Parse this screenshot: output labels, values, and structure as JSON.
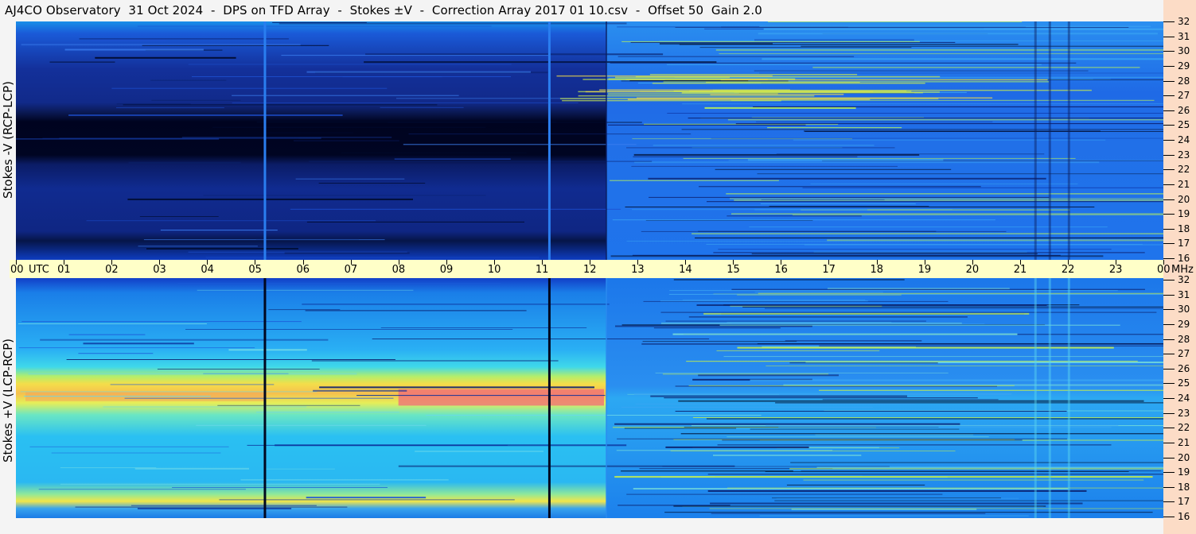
{
  "header": {
    "title": "AJ4CO Observatory  31 Oct 2024  -  DPS on TFD Array  -  Stokes ±V  -  Correction Array 2017 01 10.csv  -  Offset 50  Gain 2.0"
  },
  "colors": {
    "upper_deep": "#000a2a",
    "upper_mid": "#0d2d99",
    "upper_light": "#1a53d6",
    "lower_mid": "#1b8ef0",
    "lower_cyan": "#2ad0f5",
    "lower_yellow": "#e8f04a",
    "lower_red": "#f06a7a",
    "post_sunrise": "#1f6ff0",
    "timebar_bg": "#ffffc8",
    "freqbar_bg": "#fcdcc6"
  },
  "chart_data": [
    {
      "type": "heatmap",
      "panel": "top",
      "ylabel": "Stokes -V (RCP-LCP)",
      "x_unit": "UTC",
      "y_unit": "MHz",
      "xlim": [
        0,
        24
      ],
      "ylim": [
        16,
        32
      ],
      "x_ticks": [
        "00",
        "01",
        "02",
        "03",
        "04",
        "05",
        "06",
        "07",
        "08",
        "09",
        "10",
        "11",
        "12",
        "13",
        "14",
        "15",
        "16",
        "17",
        "18",
        "19",
        "20",
        "21",
        "22",
        "23",
        "00"
      ],
      "y_ticks": [
        "16",
        "17",
        "18",
        "19",
        "20",
        "21",
        "22",
        "23",
        "24",
        "25",
        "26",
        "27",
        "28",
        "29",
        "30",
        "31",
        "32"
      ],
      "events": [
        {
          "hour": 5.2,
          "kind": "bright vertical line"
        },
        {
          "hour": 11.15,
          "kind": "bright vertical line"
        },
        {
          "hour": 12.35,
          "kind": "background level change"
        }
      ],
      "features": [
        {
          "from_hour": 0,
          "to_hour": 11.2,
          "freq_lo": 22.8,
          "freq_hi": 24.8,
          "level": "very low"
        },
        {
          "from_hour": 11.2,
          "to_hour": 24,
          "freq_lo": 26.6,
          "freq_hi": 28.6,
          "level": "high, yellow streaks"
        }
      ]
    },
    {
      "type": "heatmap",
      "panel": "bottom",
      "ylabel": "Stokes +V (LCP-RCP)",
      "x_unit": "UTC",
      "y_unit": "MHz",
      "xlim": [
        0,
        24
      ],
      "ylim": [
        16,
        32
      ],
      "x_ticks": [
        "00",
        "01",
        "02",
        "03",
        "04",
        "05",
        "06",
        "07",
        "08",
        "09",
        "10",
        "11",
        "12",
        "13",
        "14",
        "15",
        "16",
        "17",
        "18",
        "19",
        "20",
        "21",
        "22",
        "23",
        "00"
      ],
      "y_ticks": [
        "16",
        "17",
        "18",
        "19",
        "20",
        "21",
        "22",
        "23",
        "24",
        "25",
        "26",
        "27",
        "28",
        "29",
        "30",
        "31",
        "32"
      ],
      "events": [
        {
          "hour": 5.2,
          "kind": "dark vertical line"
        },
        {
          "hour": 11.15,
          "kind": "dark vertical line"
        },
        {
          "hour": 12.35,
          "kind": "background level change"
        }
      ],
      "features": [
        {
          "from_hour": 0,
          "to_hour": 12.35,
          "freq_lo": 23.0,
          "freq_hi": 25.5,
          "level": "very high (yellow-red)"
        },
        {
          "from_hour": 5,
          "to_hour": 12,
          "freq_lo": 16.8,
          "freq_hi": 18.0,
          "level": "high (yellow)"
        }
      ]
    }
  ],
  "axis": {
    "utc_label": "UTC",
    "mhz_label": "MHz"
  }
}
